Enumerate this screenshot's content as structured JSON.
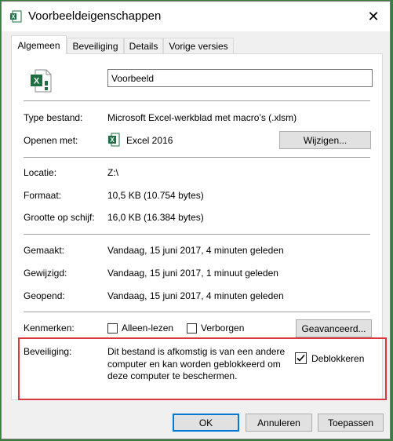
{
  "window": {
    "title": "Voorbeeldeigenschappen",
    "close_glyph": "✕"
  },
  "tabs": [
    {
      "label": "Algemeen",
      "active": true
    },
    {
      "label": "Beveiliging",
      "active": false
    },
    {
      "label": "Details",
      "active": false
    },
    {
      "label": "Vorige versies",
      "active": false
    }
  ],
  "file": {
    "name": "Voorbeeld",
    "icon": "excel-macro-file-icon"
  },
  "type_row": {
    "label": "Type bestand:",
    "value": "Microsoft Excel-werkblad met macro’s (.xlsm)"
  },
  "opens_row": {
    "label": "Openen met:",
    "app": "Excel 2016",
    "app_icon": "excel-icon",
    "change_button": "Wijzigen..."
  },
  "location_row": {
    "label": "Locatie:",
    "value": "Z:\\"
  },
  "size_row": {
    "label": "Formaat:",
    "value": "10,5 KB (10.754 bytes)"
  },
  "disk_size_row": {
    "label": "Grootte op schijf:",
    "value": "16,0 KB (16.384 bytes)"
  },
  "created_row": {
    "label": "Gemaakt:",
    "value": "Vandaag, 15 juni 2017, 4 minuten geleden"
  },
  "modified_row": {
    "label": "Gewijzigd:",
    "value": "Vandaag, 15 juni 2017, 1 minuut geleden"
  },
  "accessed_row": {
    "label": "Geopend:",
    "value": "Vandaag, 15 juni 2017, 4 minuten geleden"
  },
  "attributes_row": {
    "label": "Kenmerken:",
    "readonly_label": "Alleen-lezen",
    "readonly_checked": false,
    "hidden_label": "Verborgen",
    "hidden_checked": false,
    "advanced_button": "Geavanceerd..."
  },
  "security_row": {
    "label": "Beveiliging:",
    "text_line1": "Dit bestand is afkomstig is van een andere",
    "text_line2": "computer en kan worden geblokkeerd om",
    "text_line3": "deze computer te beschermen.",
    "unblock_label": "Deblokkeren",
    "unblock_checked": true,
    "highlight_color": "#d9393b"
  },
  "footer": {
    "ok_button": "OK",
    "cancel_button": "Annuleren",
    "apply_button": "Toepassen"
  },
  "colors": {
    "excel_green": "#1d6f42",
    "accent_blue": "#0078d7"
  }
}
